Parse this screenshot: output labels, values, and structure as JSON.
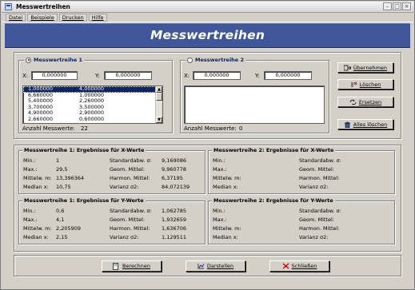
{
  "window": {
    "title": "Messwertreihen"
  },
  "menu": [
    "Datei",
    "Beispiele",
    "Drucken",
    "Hilfe"
  ],
  "banner": {
    "title": "Messwertreihen"
  },
  "series1": {
    "label": "Messwertreihe 1",
    "selected": true,
    "x_label": "X:",
    "x_value": "0,000000",
    "y_label": "Y:",
    "y_value": "0,000000",
    "rows": [
      [
        "1,000000",
        "4,000000"
      ],
      [
        "6,660000",
        "1,000000"
      ],
      [
        "5,400000",
        "2,260000"
      ],
      [
        "3,700000",
        "3,500000"
      ],
      [
        "4,900000",
        "2,900000"
      ],
      [
        "2,660000",
        "0,600000"
      ]
    ],
    "count_label": "Anzahl Messwerte:",
    "count": "22"
  },
  "series2": {
    "label": "Messwertreihe 2",
    "selected": false,
    "x_label": "X:",
    "x_value": "0,000000",
    "y_label": "Y:",
    "y_value": "0,000000",
    "count_label": "Anzahl Messwerte:",
    "count": "0"
  },
  "side_buttons": {
    "uebernehmen": "Übernehmen",
    "loeschen": "Löschen",
    "ersetzen": "Ersetzen",
    "alles_loeschen": "Alles löschen"
  },
  "results": {
    "r1x": {
      "title": "Messwertreihe 1:  Ergebnisse für X-Werte",
      "left": [
        [
          "Min.:",
          "1"
        ],
        [
          "Max.:",
          "29,5"
        ],
        [
          "Mittelw. m:",
          "13,396364"
        ],
        [
          "Median x:",
          "10,75"
        ]
      ],
      "right": [
        [
          "Standardabw. σ:",
          "9,169086"
        ],
        [
          "Geom. Mittel:",
          "9,960778"
        ],
        [
          "Harmon. Mittel:",
          "6,37195"
        ],
        [
          "Varianz σ2:",
          "84,072139"
        ]
      ]
    },
    "r2x": {
      "title": "Messwertreihe 2:  Ergebnisse für X-Werte",
      "left": [
        [
          "Min.:",
          ""
        ],
        [
          "Max.:",
          ""
        ],
        [
          "Mittelw. m:",
          ""
        ],
        [
          "Median x:",
          ""
        ]
      ],
      "right": [
        [
          "Standardabw. σ:",
          ""
        ],
        [
          "Geom. Mittel:",
          ""
        ],
        [
          "Harmon. Mittel:",
          ""
        ],
        [
          "Varianz σ2:",
          ""
        ]
      ]
    },
    "r1y": {
      "title": "Messwertreihe 1:  Ergebnisse für Y-Werte",
      "left": [
        [
          "Min.:",
          "0,6"
        ],
        [
          "Max.:",
          "4,1"
        ],
        [
          "Mittelw. m:",
          "2,205909"
        ],
        [
          "Median x:",
          "2,15"
        ]
      ],
      "right": [
        [
          "Standardabw. σ:",
          "1,062785"
        ],
        [
          "Geom. Mittel:",
          "1,932659"
        ],
        [
          "Harmon. Mittel:",
          "1,636706"
        ],
        [
          "Varianz σ2:",
          "1,129511"
        ]
      ]
    },
    "r2y": {
      "title": "Messwertreihe 2:  Ergebnisse für Y-Werte",
      "left": [
        [
          "Min.:",
          ""
        ],
        [
          "Max.:",
          ""
        ],
        [
          "Mittelw. m:",
          ""
        ],
        [
          "Median x:",
          ""
        ]
      ],
      "right": [
        [
          "Standardabw. σ:",
          ""
        ],
        [
          "Geom. Mittel:",
          ""
        ],
        [
          "Harmon. Mittel:",
          ""
        ],
        [
          "Varianz σ2:",
          ""
        ]
      ]
    }
  },
  "bottom_buttons": {
    "berechnen": "Berechnen",
    "darstellen": "Darstellen",
    "schliessen": "Schließen"
  },
  "colors": {
    "banner": "#3f569a",
    "selection": "#0a246a",
    "face": "#d4d0c8"
  }
}
